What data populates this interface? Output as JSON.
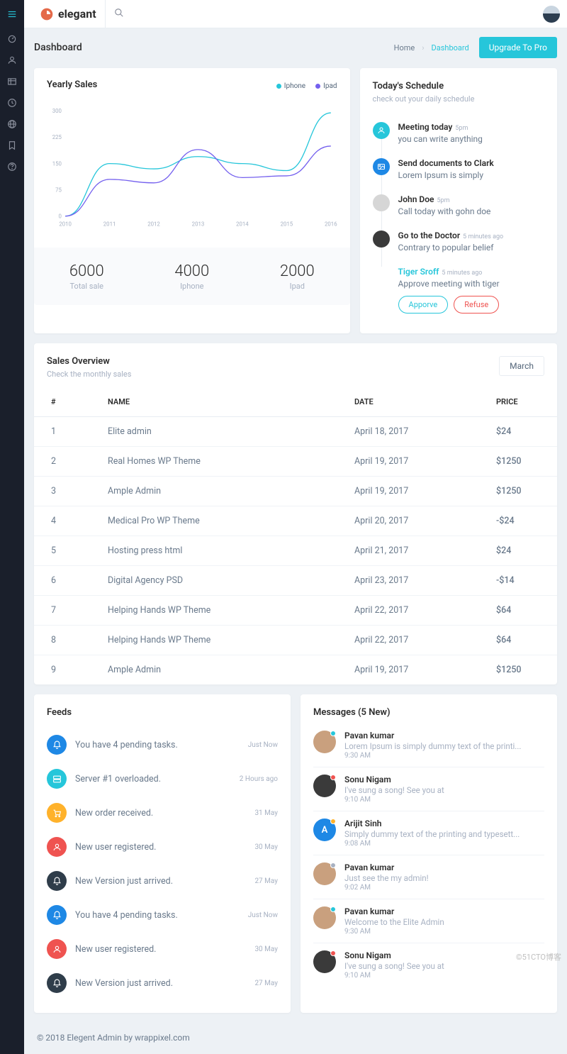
{
  "brand": "elegant",
  "page_title": "Dashboard",
  "breadcrumb": {
    "home": "Home",
    "current": "Dashboard"
  },
  "upgrade_btn": "Upgrade To Pro",
  "footer": "© 2018 Elegent Admin by wrappixel.com",
  "watermark": "©51CTO博客",
  "chart_data": {
    "type": "line",
    "title": "Yearly Sales",
    "xlabel": "",
    "ylabel": "",
    "ylim": [
      0,
      300
    ],
    "yticks": [
      0,
      75,
      150,
      225,
      300
    ],
    "categories": [
      "2010",
      "2011",
      "2012",
      "2013",
      "2014",
      "2015",
      "2016"
    ],
    "series": [
      {
        "name": "Iphone",
        "color": "#26c6da",
        "values": [
          0,
          150,
          135,
          170,
          150,
          130,
          295
        ]
      },
      {
        "name": "Ipad",
        "color": "#7460ee",
        "values": [
          0,
          105,
          95,
          190,
          110,
          115,
          200
        ]
      }
    ],
    "legend_position": "top-right",
    "stats": [
      {
        "value": "6000",
        "label": "Total sale"
      },
      {
        "value": "4000",
        "label": "Iphone"
      },
      {
        "value": "2000",
        "label": "Ipad"
      }
    ]
  },
  "schedule": {
    "title": "Today's Schedule",
    "subtitle": "check out your daily schedule",
    "items": [
      {
        "avatar_bg": "#26c6da",
        "avatar_kind": "icon-user",
        "title": "Meeting today",
        "time": "5pm",
        "desc": "you can write anything",
        "link": false
      },
      {
        "avatar_bg": "#1e88e5",
        "avatar_kind": "icon-image",
        "title": "Send documents to Clark",
        "time": "",
        "desc": "Lorem Ipsum is simply",
        "link": false
      },
      {
        "avatar_bg": "#d6d6d6",
        "avatar_kind": "photo",
        "title": "John Doe",
        "time": "5pm",
        "desc": "Call today with gohn doe",
        "link": false
      },
      {
        "avatar_bg": "#3a3a3a",
        "avatar_kind": "photo",
        "title": "Go to the Doctor",
        "time": "5 minutes ago",
        "desc": "Contrary to popular belief",
        "link": false
      },
      {
        "avatar_bg": "#ffffff",
        "avatar_kind": "photo",
        "title": "Tiger Sroff",
        "time": "5 minutes ago",
        "desc": "Approve meeting with tiger",
        "link": true,
        "actions": {
          "approve": "Apporve",
          "refuse": "Refuse"
        }
      }
    ]
  },
  "sales": {
    "title": "Sales Overview",
    "subtitle": "Check the monthly sales",
    "month": "March",
    "columns": {
      "idx": "#",
      "name": "NAME",
      "date": "DATE",
      "price": "PRICE"
    },
    "rows": [
      {
        "idx": "1",
        "name": "Elite admin",
        "date": "April 18, 2017",
        "price": "$24",
        "neg": false
      },
      {
        "idx": "2",
        "name": "Real Homes WP Theme",
        "date": "April 19, 2017",
        "price": "$1250",
        "neg": false
      },
      {
        "idx": "3",
        "name": "Ample Admin",
        "date": "April 19, 2017",
        "price": "$1250",
        "neg": false
      },
      {
        "idx": "4",
        "name": "Medical Pro WP Theme",
        "date": "April 20, 2017",
        "price": "-$24",
        "neg": true
      },
      {
        "idx": "5",
        "name": "Hosting press html",
        "date": "April 21, 2017",
        "price": "$24",
        "neg": false
      },
      {
        "idx": "6",
        "name": "Digital Agency PSD",
        "date": "April 23, 2017",
        "price": "-$14",
        "neg": true
      },
      {
        "idx": "7",
        "name": "Helping Hands WP Theme",
        "date": "April 22, 2017",
        "price": "$64",
        "neg": false
      },
      {
        "idx": "8",
        "name": "Helping Hands WP Theme",
        "date": "April 22, 2017",
        "price": "$64",
        "neg": false
      },
      {
        "idx": "9",
        "name": "Ample Admin",
        "date": "April 19, 2017",
        "price": "$1250",
        "neg": false
      }
    ]
  },
  "feeds": {
    "title": "Feeds",
    "items": [
      {
        "icon": "bell",
        "bg": "#1e88e5",
        "text": "You have 4 pending tasks.",
        "time": "Just Now"
      },
      {
        "icon": "server",
        "bg": "#26c6da",
        "text": "Server #1 overloaded.",
        "time": "2 Hours ago"
      },
      {
        "icon": "cart",
        "bg": "#ffb22b",
        "text": "New order received.",
        "time": "31 May"
      },
      {
        "icon": "user",
        "bg": "#ef5350",
        "text": "New user registered.",
        "time": "30 May"
      },
      {
        "icon": "bell",
        "bg": "#2f3d4a",
        "text": "New Version just arrived.",
        "time": "27 May"
      },
      {
        "icon": "bell",
        "bg": "#1e88e5",
        "text": "You have 4 pending tasks.",
        "time": "Just Now"
      },
      {
        "icon": "user",
        "bg": "#ef5350",
        "text": "New user registered.",
        "time": "30 May"
      },
      {
        "icon": "bell",
        "bg": "#2f3d4a",
        "text": "New Version just arrived.",
        "time": "27 May"
      }
    ]
  },
  "messages": {
    "title": "Messages (5 New)",
    "items": [
      {
        "bg": "#c9a07e",
        "status": "#26c6da",
        "name": "Pavan kumar",
        "text": "Lorem Ipsum is simply dummy text of the printi...",
        "time": "9:30 AM"
      },
      {
        "bg": "#3a3a3a",
        "status": "#ef5350",
        "name": "Sonu Nigam",
        "text": "I've sung a song! See you at",
        "time": "9:10 AM"
      },
      {
        "bg": "#1e88e5",
        "status": "#ffb22b",
        "name": "Arijit Sinh",
        "text": "Simply dummy text of the printing and typesett...",
        "time": "9:08 AM",
        "initial": "A"
      },
      {
        "bg": "#c9a07e",
        "status": "#a7b1c2",
        "name": "Pavan kumar",
        "text": "Just see the my admin!",
        "time": "9:02 AM"
      },
      {
        "bg": "#c9a07e",
        "status": "#26c6da",
        "name": "Pavan kumar",
        "text": "Welcome to the Elite Admin",
        "time": "9:30 AM"
      },
      {
        "bg": "#3a3a3a",
        "status": "#ef5350",
        "name": "Sonu Nigam",
        "text": "I've sung a song! See you at",
        "time": "9:10 AM"
      }
    ]
  }
}
